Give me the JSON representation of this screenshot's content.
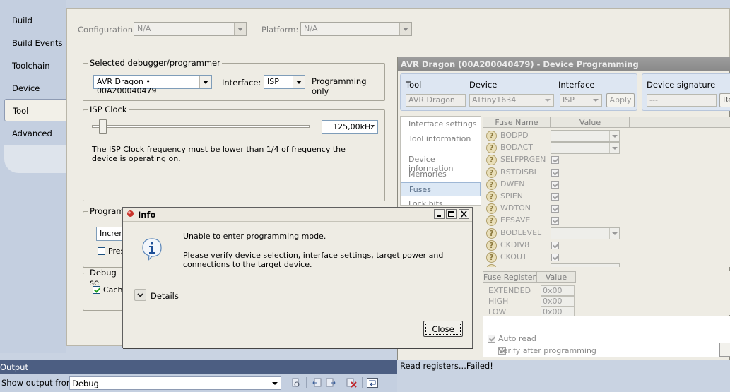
{
  "leftnav": {
    "items": [
      {
        "label": "Build",
        "active": false
      },
      {
        "label": "Build Events",
        "active": false
      },
      {
        "label": "Toolchain",
        "active": false
      },
      {
        "label": "Device",
        "active": false
      },
      {
        "label": "Tool",
        "active": true
      },
      {
        "label": "Advanced",
        "active": false
      }
    ]
  },
  "config": {
    "configuration_label": "Configuration:",
    "configuration_value": "N/A",
    "platform_label": "Platform:",
    "platform_value": "N/A"
  },
  "debugger": {
    "group_title": "Selected debugger/programmer",
    "tool_value": "AVR Dragon • 00A200040479",
    "interface_label": "Interface:",
    "interface_value": "ISP",
    "mode_text": "Programming only"
  },
  "isp_clock": {
    "group_title": "ISP Clock",
    "value": "125,00kHz",
    "slider_fraction": 0.05,
    "note": "The ISP Clock frequency must be lower than 1/4 of frequency the device is operating on."
  },
  "programming": {
    "group_title_partial": "Programm",
    "erase_value_partial": "Increm",
    "preserve_label_partial": "Pres"
  },
  "debug_settings": {
    "group_title_partial": "Debug se",
    "cache_label_partial": "Cache"
  },
  "device_programming": {
    "title": "AVR Dragon (00A200040479) - Device Programming",
    "tool_label": "Tool",
    "tool_value": "AVR Dragon",
    "device_label": "Device",
    "device_value": "ATtiny1634",
    "interface_label": "Interface",
    "interface_value": "ISP",
    "apply_label": "Apply",
    "signature_label": "Device signature",
    "signature_value": "---",
    "read_label_partial": "Re",
    "sidebar": [
      {
        "label": "Interface settings",
        "selected": false
      },
      {
        "label": "Tool information",
        "selected": false
      },
      {
        "label": "Device information",
        "selected": false
      },
      {
        "label": "Memories",
        "selected": false
      },
      {
        "label": "Fuses",
        "selected": true
      },
      {
        "label": "Lock bits",
        "selected": false
      }
    ],
    "fuse_headers": {
      "name": "Fuse Name",
      "value": "Value"
    },
    "fuses": [
      {
        "name": "BODPD",
        "type": "combo",
        "checked": false
      },
      {
        "name": "BODACT",
        "type": "combo",
        "checked": false
      },
      {
        "name": "SELFPRGEN",
        "type": "check",
        "checked": true
      },
      {
        "name": "RSTDISBL",
        "type": "check",
        "checked": true
      },
      {
        "name": "DWEN",
        "type": "check",
        "checked": true
      },
      {
        "name": "SPIEN",
        "type": "check",
        "checked": true
      },
      {
        "name": "WDTON",
        "type": "check",
        "checked": true
      },
      {
        "name": "EESAVE",
        "type": "check",
        "checked": true
      },
      {
        "name": "BODLEVEL",
        "type": "combo",
        "checked": false
      },
      {
        "name": "CKDIV8",
        "type": "check",
        "checked": true
      },
      {
        "name": "CKOUT",
        "type": "check",
        "checked": true
      }
    ],
    "register_headers": {
      "name": "Fuse Register",
      "value": "Value"
    },
    "registers": [
      {
        "name": "EXTENDED",
        "value": "0x00"
      },
      {
        "name": "HIGH",
        "value": "0x00"
      },
      {
        "name": "LOW",
        "value": "0x00"
      }
    ],
    "auto_read_label": "Auto read",
    "verify_label": "Verify after programming",
    "status_message": "Read registers...Failed!"
  },
  "output": {
    "title_partial": "Output",
    "show_from_label": "Show output from:",
    "show_from_value": "Debug"
  },
  "dialog": {
    "title": "Info",
    "message": "Unable to enter programming mode.",
    "detail": "Please verify device selection, interface settings, target power and connections to the target device.",
    "details_label": "Details",
    "close_label": "Close"
  }
}
